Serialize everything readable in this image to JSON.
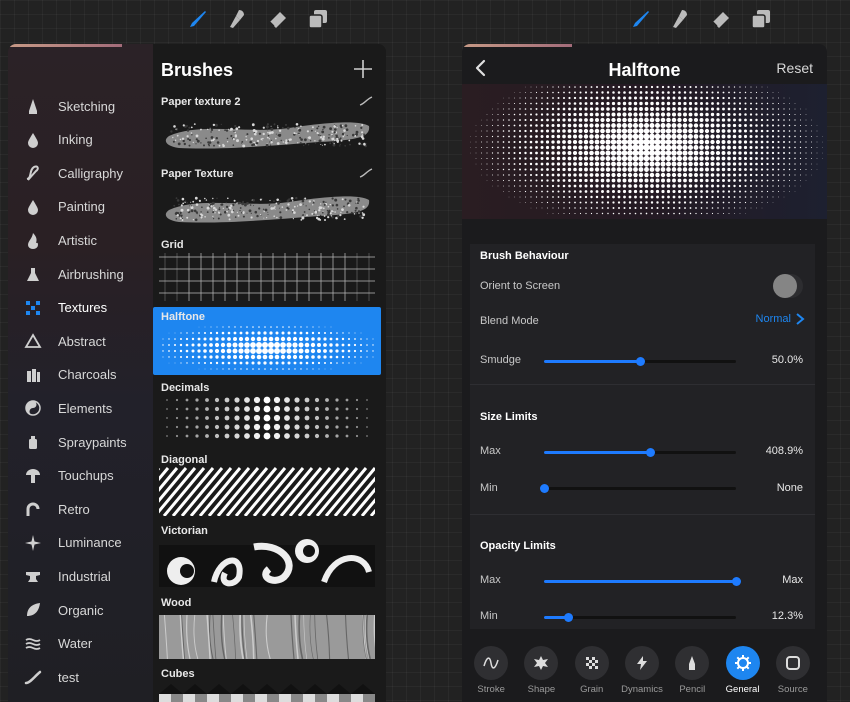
{
  "toolbar_left": [
    {
      "name": "brush-tool-icon",
      "active": true
    },
    {
      "name": "smudge-tool-icon",
      "active": false
    },
    {
      "name": "eraser-tool-icon",
      "active": false
    },
    {
      "name": "layers-icon",
      "active": false
    }
  ],
  "toolbar_right": [
    {
      "name": "brush-tool-icon",
      "active": true
    },
    {
      "name": "smudge-tool-icon",
      "active": false
    },
    {
      "name": "eraser-tool-icon",
      "active": false
    },
    {
      "name": "layers-icon",
      "active": false
    }
  ],
  "colors": {
    "accent": "#1e86f0",
    "panel": "#1d1d1f",
    "canvas": "#222222"
  },
  "library": {
    "title": "Brushes",
    "add_icon": "plus-icon",
    "categories": [
      {
        "label": "Sketching",
        "icon": "pencil-tip-icon",
        "active": false
      },
      {
        "label": "Inking",
        "icon": "ink-drop-icon",
        "active": false
      },
      {
        "label": "Calligraphy",
        "icon": "calligraphy-stroke-icon",
        "active": false
      },
      {
        "label": "Painting",
        "icon": "paint-drop-icon",
        "active": false
      },
      {
        "label": "Artistic",
        "icon": "flame-icon",
        "active": false
      },
      {
        "label": "Airbrushing",
        "icon": "airbrush-icon",
        "active": false
      },
      {
        "label": "Textures",
        "icon": "checker-texture-icon",
        "active": true
      },
      {
        "label": "Abstract",
        "icon": "triangle-icon",
        "active": false
      },
      {
        "label": "Charcoals",
        "icon": "charcoal-sticks-icon",
        "active": false
      },
      {
        "label": "Elements",
        "icon": "yin-yang-icon",
        "active": false
      },
      {
        "label": "Spraypaints",
        "icon": "spray-can-icon",
        "active": false
      },
      {
        "label": "Touchups",
        "icon": "mushroom-brush-icon",
        "active": false
      },
      {
        "label": "Retro",
        "icon": "retro-arc-icon",
        "active": false
      },
      {
        "label": "Luminance",
        "icon": "sparkle-icon",
        "active": false
      },
      {
        "label": "Industrial",
        "icon": "anvil-icon",
        "active": false
      },
      {
        "label": "Organic",
        "icon": "leaf-icon",
        "active": false
      },
      {
        "label": "Water",
        "icon": "waves-icon",
        "active": false
      },
      {
        "label": "test",
        "icon": "brush-stroke-icon",
        "active": false
      }
    ],
    "brushes": [
      {
        "name": "Paper texture 2",
        "style": "paper2",
        "selected": false
      },
      {
        "name": "Paper Texture",
        "style": "paper",
        "selected": false
      },
      {
        "name": "Grid",
        "style": "grid",
        "selected": false
      },
      {
        "name": "Halftone",
        "style": "halftone",
        "selected": true
      },
      {
        "name": "Decimals",
        "style": "decimals",
        "selected": false
      },
      {
        "name": "Diagonal",
        "style": "diagonal",
        "selected": false
      },
      {
        "name": "Victorian",
        "style": "victorian",
        "selected": false
      },
      {
        "name": "Wood",
        "style": "wood",
        "selected": false
      },
      {
        "name": "Cubes",
        "style": "cubes",
        "selected": false
      }
    ]
  },
  "studio": {
    "title": "Halftone",
    "reset_label": "Reset",
    "brush_behaviour": {
      "title": "Brush Behaviour",
      "orient_label": "Orient to Screen",
      "orient_on": false,
      "blend_label": "Blend Mode",
      "blend_value": "Normal",
      "smudge_label": "Smudge",
      "smudge_value": "50.0%",
      "smudge_level": 0.5
    },
    "size_limits": {
      "title": "Size Limits",
      "max_label": "Max",
      "max_value": "408.9%",
      "max_level": 0.55,
      "min_label": "Min",
      "min_value": "None",
      "min_level": 0.0
    },
    "opacity_limits": {
      "title": "Opacity Limits",
      "max_label": "Max",
      "max_value": "Max",
      "max_level": 1.0,
      "min_label": "Min",
      "min_value": "12.3%",
      "min_level": 0.123
    },
    "tabs": [
      {
        "label": "Stroke",
        "icon": "stroke-wave-icon",
        "active": false
      },
      {
        "label": "Shape",
        "icon": "shape-splat-icon",
        "active": false
      },
      {
        "label": "Grain",
        "icon": "grain-checker-icon",
        "active": false
      },
      {
        "label": "Dynamics",
        "icon": "lightning-icon",
        "active": false
      },
      {
        "label": "Pencil",
        "icon": "pencil-icon",
        "active": false
      },
      {
        "label": "General",
        "icon": "gear-icon",
        "active": true
      },
      {
        "label": "Source",
        "icon": "source-square-icon",
        "active": false
      }
    ]
  }
}
